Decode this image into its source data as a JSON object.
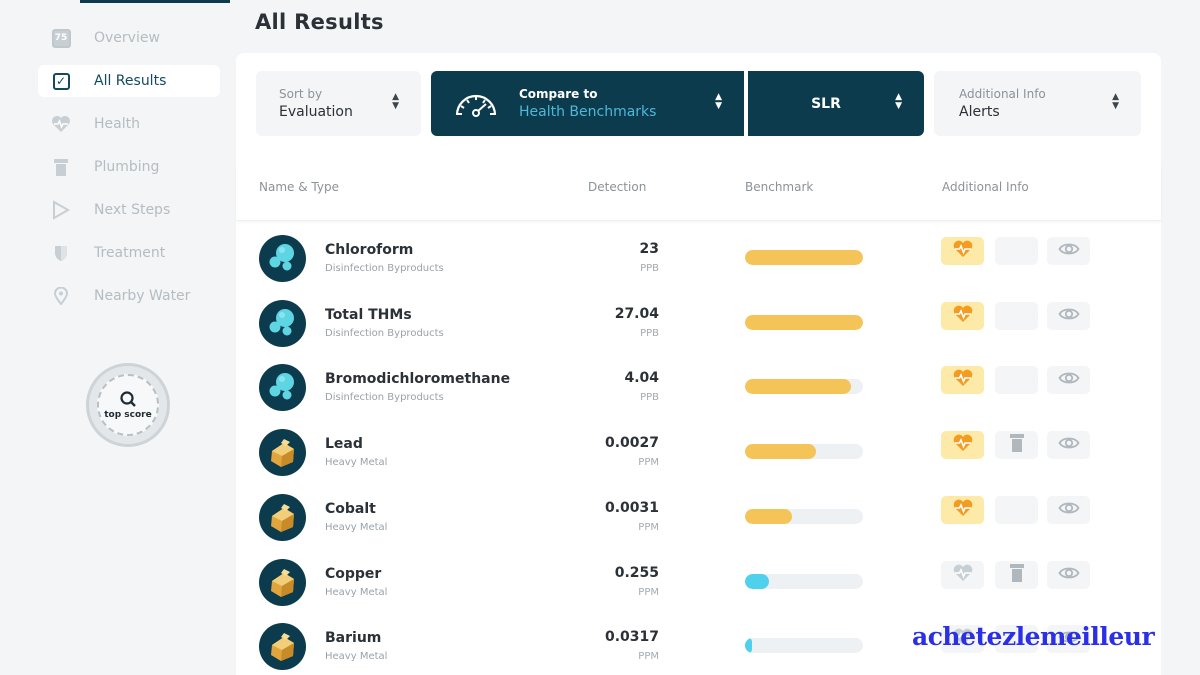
{
  "page_title": "All Results",
  "sidebar": {
    "items": [
      {
        "label": "Overview",
        "icon": "score-75-icon",
        "icon_text": "75",
        "active": false
      },
      {
        "label": "All Results",
        "icon": "checkbox-icon",
        "active": true
      },
      {
        "label": "Health",
        "icon": "heart-pulse-icon",
        "active": false
      },
      {
        "label": "Plumbing",
        "icon": "pipe-icon",
        "active": false
      },
      {
        "label": "Next Steps",
        "icon": "play-arrow-icon",
        "active": false
      },
      {
        "label": "Treatment",
        "icon": "shield-icon",
        "active": false
      },
      {
        "label": "Nearby Water",
        "icon": "location-pin-icon",
        "active": false
      }
    ],
    "badge": {
      "text": "top score"
    }
  },
  "toolbar": {
    "sort": {
      "label": "Sort by",
      "value": "Evaluation"
    },
    "compare": {
      "label": "Compare to",
      "value": "Health Benchmarks"
    },
    "standard": {
      "value": "SLR"
    },
    "additional": {
      "label": "Additional Info",
      "value": "Alerts"
    }
  },
  "table": {
    "headers": {
      "name": "Name & Type",
      "detection": "Detection",
      "benchmark": "Benchmark",
      "info": "Additional Info"
    },
    "rows": [
      {
        "name": "Chloroform",
        "type": "Disinfection Byproducts",
        "value": "23",
        "unit": "PPB",
        "benchmark_fill": 1.0,
        "bar_color": "#f5c458",
        "icon": "bubbles-icon",
        "health_alert": true,
        "plumbing_alert": false
      },
      {
        "name": "Total THMs",
        "type": "Disinfection Byproducts",
        "value": "27.04",
        "unit": "PPB",
        "benchmark_fill": 1.0,
        "bar_color": "#f5c458",
        "icon": "bubbles-icon",
        "health_alert": true,
        "plumbing_alert": false
      },
      {
        "name": "Bromodichloromethane",
        "type": "Disinfection Byproducts",
        "value": "4.04",
        "unit": "PPB",
        "benchmark_fill": 0.9,
        "bar_color": "#f5c458",
        "icon": "bubbles-icon",
        "health_alert": true,
        "plumbing_alert": false
      },
      {
        "name": "Lead",
        "type": "Heavy Metal",
        "value": "0.0027",
        "unit": "PPM",
        "benchmark_fill": 0.6,
        "bar_color": "#f5c458",
        "icon": "metal-nugget-icon",
        "health_alert": true,
        "plumbing_alert": true
      },
      {
        "name": "Cobalt",
        "type": "Heavy Metal",
        "value": "0.0031",
        "unit": "PPM",
        "benchmark_fill": 0.4,
        "bar_color": "#f5c458",
        "icon": "metal-nugget-icon",
        "health_alert": true,
        "plumbing_alert": false
      },
      {
        "name": "Copper",
        "type": "Heavy Metal",
        "value": "0.255",
        "unit": "PPM",
        "benchmark_fill": 0.2,
        "bar_color": "#4fd1ee",
        "icon": "metal-nugget-icon",
        "health_alert": false,
        "plumbing_alert": true
      },
      {
        "name": "Barium",
        "type": "Heavy Metal",
        "value": "0.0317",
        "unit": "PPM",
        "benchmark_fill": 0.05,
        "bar_color": "#4fd1ee",
        "icon": "metal-nugget-icon",
        "health_alert": false,
        "plumbing_alert": false
      }
    ]
  },
  "colors": {
    "primary": "#0d3b4e",
    "accent": "#4fb7d8",
    "alert": "#f5a623",
    "bar_warning": "#f5c458",
    "bar_ok": "#4fd1ee"
  },
  "watermark": "achetezlemeilleur"
}
